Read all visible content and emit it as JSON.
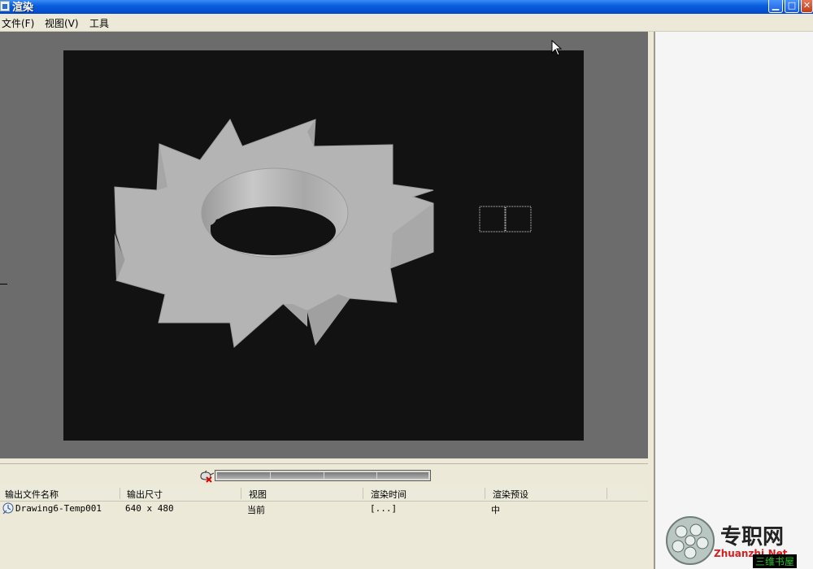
{
  "window": {
    "title": "渲染",
    "controls": [
      "minimize",
      "maximize",
      "close"
    ]
  },
  "menu": [
    {
      "label": "文件(F)"
    },
    {
      "label": "视图(V)"
    },
    {
      "label": "工具"
    }
  ],
  "viewport": {
    "background": "#6c6c6c",
    "canvas_background": "#121212",
    "object": "gear"
  },
  "progress": {
    "icon": "render-teapot-icon",
    "fraction": 0
  },
  "table": {
    "columns": [
      "输出文件名称",
      "输出尺寸",
      "视图",
      "渲染时间",
      "渲染预设"
    ],
    "rows": [
      {
        "icon": "render-entry-icon",
        "file": "Drawing6-Temp001",
        "size": "640 x 480",
        "view": "当前",
        "time": "[...]",
        "preset": "中"
      }
    ]
  },
  "watermark": {
    "title": "专职网",
    "subtitle": "Zhuanzhi.Net",
    "tag": "三维书屋"
  }
}
